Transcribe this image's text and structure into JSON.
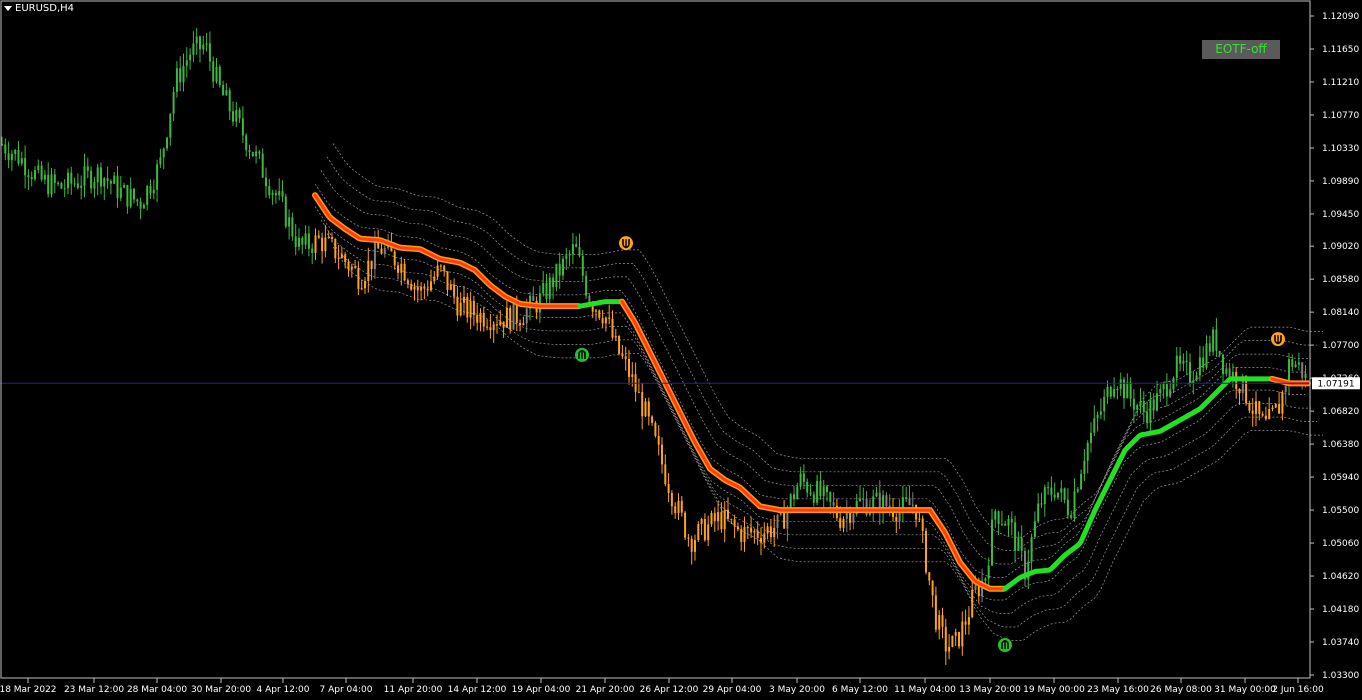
{
  "window": {
    "title": "EURUSD,H4"
  },
  "button": {
    "label": "EOTF-off"
  },
  "colors": {
    "background": "#000000",
    "bull_candle": "#3fb83f",
    "bear_candle": "#ffa31a",
    "neutral_candle": "#808080",
    "trend_down": "#ff3b1f",
    "trend_down_glow": "#ff9a00",
    "trend_up": "#22e022",
    "band": "#9a9a9a",
    "grid": "#1a1a4a",
    "current_price_line": "#2020a0"
  },
  "icons": [
    "arrow-up-signal-icon",
    "arrow-down-signal-icon"
  ],
  "chart_data": {
    "type": "line",
    "symbol": "EURUSD",
    "timeframe": "H4",
    "current_price": "1.07191",
    "y_ticks": [
      "1.12090",
      "1.11650",
      "1.11210",
      "1.10770",
      "1.10330",
      "1.09890",
      "1.09450",
      "1.09020",
      "1.08580",
      "1.08140",
      "1.07700",
      "1.07260",
      "1.06820",
      "1.06380",
      "1.05940",
      "1.05500",
      "1.05060",
      "1.04620",
      "1.04180",
      "1.03740",
      "1.03300"
    ],
    "ylim": [
      1.033,
      1.1252
    ],
    "x_ticks": [
      "18 Mar 2022",
      "23 Mar 12:00",
      "28 Mar 04:00",
      "30 Mar 20:00",
      "4 Apr 12:00",
      "7 Apr 04:00",
      "11 Apr 20:00",
      "14 Apr 12:00",
      "19 Apr 04:00",
      "21 Apr 20:00",
      "26 Apr 12:00",
      "29 Apr 04:00",
      "3 May 20:00",
      "6 May 12:00",
      "11 May 04:00",
      "13 May 20:00",
      "19 May 00:00",
      "23 May 16:00",
      "26 May 08:00",
      "31 May 00:00",
      "2 Jun 16:00"
    ],
    "price_path": [
      [
        0,
        1.104
      ],
      [
        20,
        1.102
      ],
      [
        40,
        1.099
      ],
      [
        60,
        1.098
      ],
      [
        80,
        1.099
      ],
      [
        100,
        1.1
      ],
      [
        120,
        1.0975
      ],
      [
        140,
        1.096
      ],
      [
        160,
        1.101
      ],
      [
        175,
        1.112
      ],
      [
        190,
        1.116
      ],
      [
        205,
        1.117
      ],
      [
        220,
        1.111
      ],
      [
        240,
        1.106
      ],
      [
        260,
        1.101
      ],
      [
        280,
        1.096
      ],
      [
        300,
        1.09
      ],
      [
        320,
        1.091
      ],
      [
        340,
        1.089
      ],
      [
        360,
        1.086
      ],
      [
        380,
        1.09
      ],
      [
        400,
        1.088
      ],
      [
        420,
        1.084
      ],
      [
        440,
        1.087
      ],
      [
        460,
        1.082
      ],
      [
        480,
        1.081
      ],
      [
        500,
        1.0805
      ],
      [
        520,
        1.081
      ],
      [
        540,
        1.083
      ],
      [
        555,
        1.086
      ],
      [
        565,
        1.088
      ],
      [
        575,
        1.09
      ],
      [
        590,
        1.083
      ],
      [
        605,
        1.081
      ],
      [
        615,
        1.077
      ],
      [
        630,
        1.073
      ],
      [
        645,
        1.068
      ],
      [
        660,
        1.062
      ],
      [
        675,
        1.056
      ],
      [
        690,
        1.051
      ],
      [
        700,
        1.052
      ],
      [
        720,
        1.054
      ],
      [
        740,
        1.052
      ],
      [
        760,
        1.052
      ],
      [
        780,
        1.053
      ],
      [
        800,
        1.059
      ],
      [
        820,
        1.057
      ],
      [
        840,
        1.054
      ],
      [
        860,
        1.056
      ],
      [
        880,
        1.056
      ],
      [
        900,
        1.055
      ],
      [
        915,
        1.056
      ],
      [
        925,
        1.049
      ],
      [
        935,
        1.041
      ],
      [
        945,
        1.037
      ],
      [
        955,
        1.037
      ],
      [
        965,
        1.04
      ],
      [
        975,
        1.044
      ],
      [
        985,
        1.046
      ],
      [
        995,
        1.055
      ],
      [
        1010,
        1.053
      ],
      [
        1025,
        1.047
      ],
      [
        1040,
        1.056
      ],
      [
        1055,
        1.058
      ],
      [
        1070,
        1.055
      ],
      [
        1085,
        1.063
      ],
      [
        1100,
        1.068
      ],
      [
        1115,
        1.073
      ],
      [
        1130,
        1.07
      ],
      [
        1145,
        1.068
      ],
      [
        1160,
        1.07
      ],
      [
        1175,
        1.074
      ],
      [
        1190,
        1.073
      ],
      [
        1205,
        1.076
      ],
      [
        1215,
        1.078
      ],
      [
        1225,
        1.074
      ],
      [
        1240,
        1.072
      ],
      [
        1255,
        1.068
      ],
      [
        1265,
        1.066
      ],
      [
        1280,
        1.069
      ],
      [
        1290,
        1.075
      ],
      [
        1300,
        1.074
      ],
      [
        1308,
        1.0719
      ]
    ],
    "trend_line": [
      [
        315,
        1.097
      ],
      [
        330,
        1.094
      ],
      [
        345,
        1.0925
      ],
      [
        360,
        1.0912
      ],
      [
        380,
        1.091
      ],
      [
        400,
        1.09
      ],
      [
        420,
        1.0898
      ],
      [
        440,
        1.0885
      ],
      [
        460,
        1.088
      ],
      [
        475,
        1.087
      ],
      [
        490,
        1.085
      ],
      [
        505,
        1.0835
      ],
      [
        520,
        1.0825
      ],
      [
        540,
        1.0822
      ],
      [
        560,
        1.0822
      ],
      [
        580,
        1.0822
      ],
      [
        605,
        1.0828
      ],
      [
        622,
        1.0828
      ],
      [
        635,
        1.08
      ],
      [
        650,
        1.076
      ],
      [
        665,
        1.072
      ],
      [
        680,
        1.068
      ],
      [
        695,
        1.064
      ],
      [
        710,
        1.0605
      ],
      [
        725,
        1.059
      ],
      [
        740,
        1.058
      ],
      [
        760,
        1.0555
      ],
      [
        780,
        1.055
      ],
      [
        820,
        1.055
      ],
      [
        860,
        1.055
      ],
      [
        900,
        1.055
      ],
      [
        930,
        1.055
      ],
      [
        945,
        1.052
      ],
      [
        960,
        1.048
      ],
      [
        975,
        1.0455
      ],
      [
        990,
        1.0445
      ],
      [
        1005,
        1.0445
      ],
      [
        1020,
        1.046
      ],
      [
        1035,
        1.0468
      ],
      [
        1050,
        1.047
      ],
      [
        1065,
        1.049
      ],
      [
        1080,
        1.0505
      ],
      [
        1095,
        1.055
      ],
      [
        1110,
        1.059
      ],
      [
        1125,
        1.063
      ],
      [
        1140,
        1.065
      ],
      [
        1160,
        1.0655
      ],
      [
        1180,
        1.067
      ],
      [
        1200,
        1.0685
      ],
      [
        1215,
        1.0705
      ],
      [
        1230,
        1.0725
      ],
      [
        1250,
        1.0725
      ],
      [
        1272,
        1.0725
      ],
      [
        1290,
        1.0719
      ],
      [
        1308,
        1.0719
      ]
    ],
    "trend_segments": [
      {
        "from": 315,
        "to": 580,
        "color": "down"
      },
      {
        "from": 580,
        "to": 622,
        "color": "up"
      },
      {
        "from": 622,
        "to": 1005,
        "color": "down"
      },
      {
        "from": 1005,
        "to": 1272,
        "color": "up"
      },
      {
        "from": 1272,
        "to": 1308,
        "color": "down"
      }
    ],
    "signals": [
      {
        "x": 626,
        "price": 1.0906,
        "dir": "down"
      },
      {
        "x": 582,
        "price": 1.0757,
        "dir": "up"
      },
      {
        "x": 1005,
        "price": 1.037,
        "dir": "up"
      },
      {
        "x": 1278,
        "price": 1.0778,
        "dir": "down"
      }
    ]
  }
}
